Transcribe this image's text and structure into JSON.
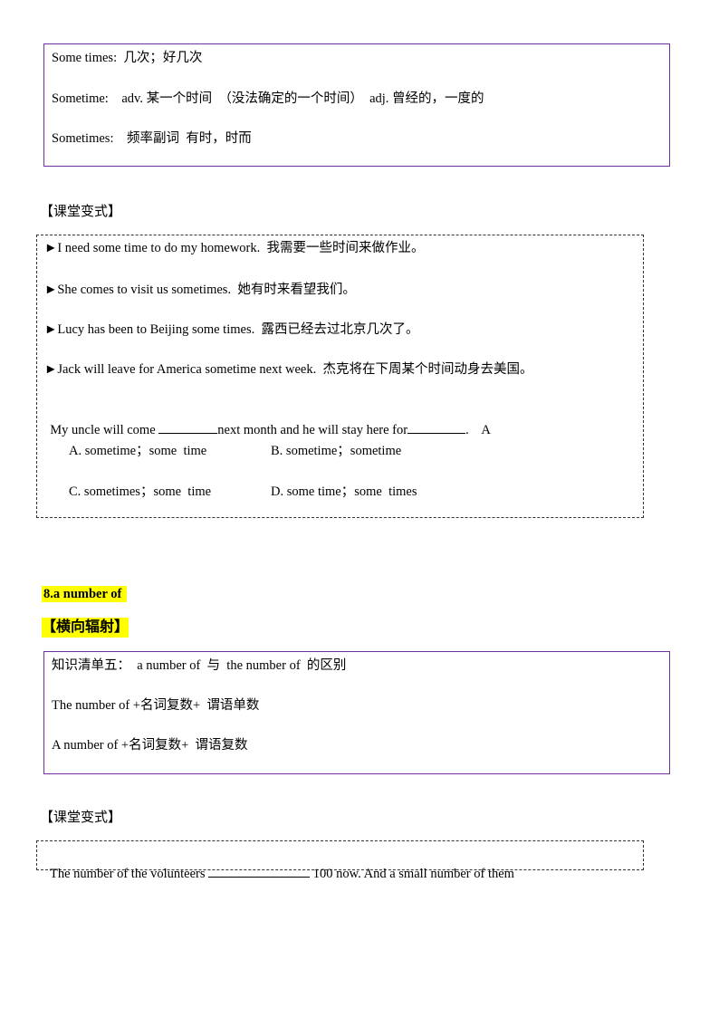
{
  "box1": {
    "lines": [
      "Some times:  几次；好几次",
      "Sometime:    adv. 某一个时间  （没法确定的一个时间）  adj. 曾经的，一度的",
      "Sometimes:    频率副词  有时，时而"
    ]
  },
  "section1_label": "【课堂变式】",
  "examples": [
    "►I need some time to do my homework.  我需要一些时间来做作业。",
    "►She comes to visit us sometimes.  她有时来看望我们。",
    "►Lucy has been to Beijing some times.  露西已经去过北京几次了。",
    "►Jack will leave for America sometime next week.  杰克将在下周某个时间动身去美国。"
  ],
  "question": {
    "part1": "My uncle will come ",
    "part2": "next month and he will stay here for",
    "part3": ".    A",
    "options": [
      "A. sometime；some  time",
      "B. sometime；sometime",
      "C. sometimes；some  time",
      "D. some time；some  times"
    ]
  },
  "heading": "8.a number of",
  "subheading": "【横向辐射】",
  "box3": {
    "lines": [
      "知识清单五：  a number of  与  the number of  的区别",
      "The number of +名词复数+  谓语单数",
      "A number of +名词复数+  谓语复数"
    ]
  },
  "section2_label": "【课堂变式】",
  "final": {
    "part1": "The number of the volunteers ",
    "part2": " 100 now. And a small number of them"
  },
  "colors": {
    "box_border": "#7030a0",
    "highlight": "#ffff00"
  }
}
